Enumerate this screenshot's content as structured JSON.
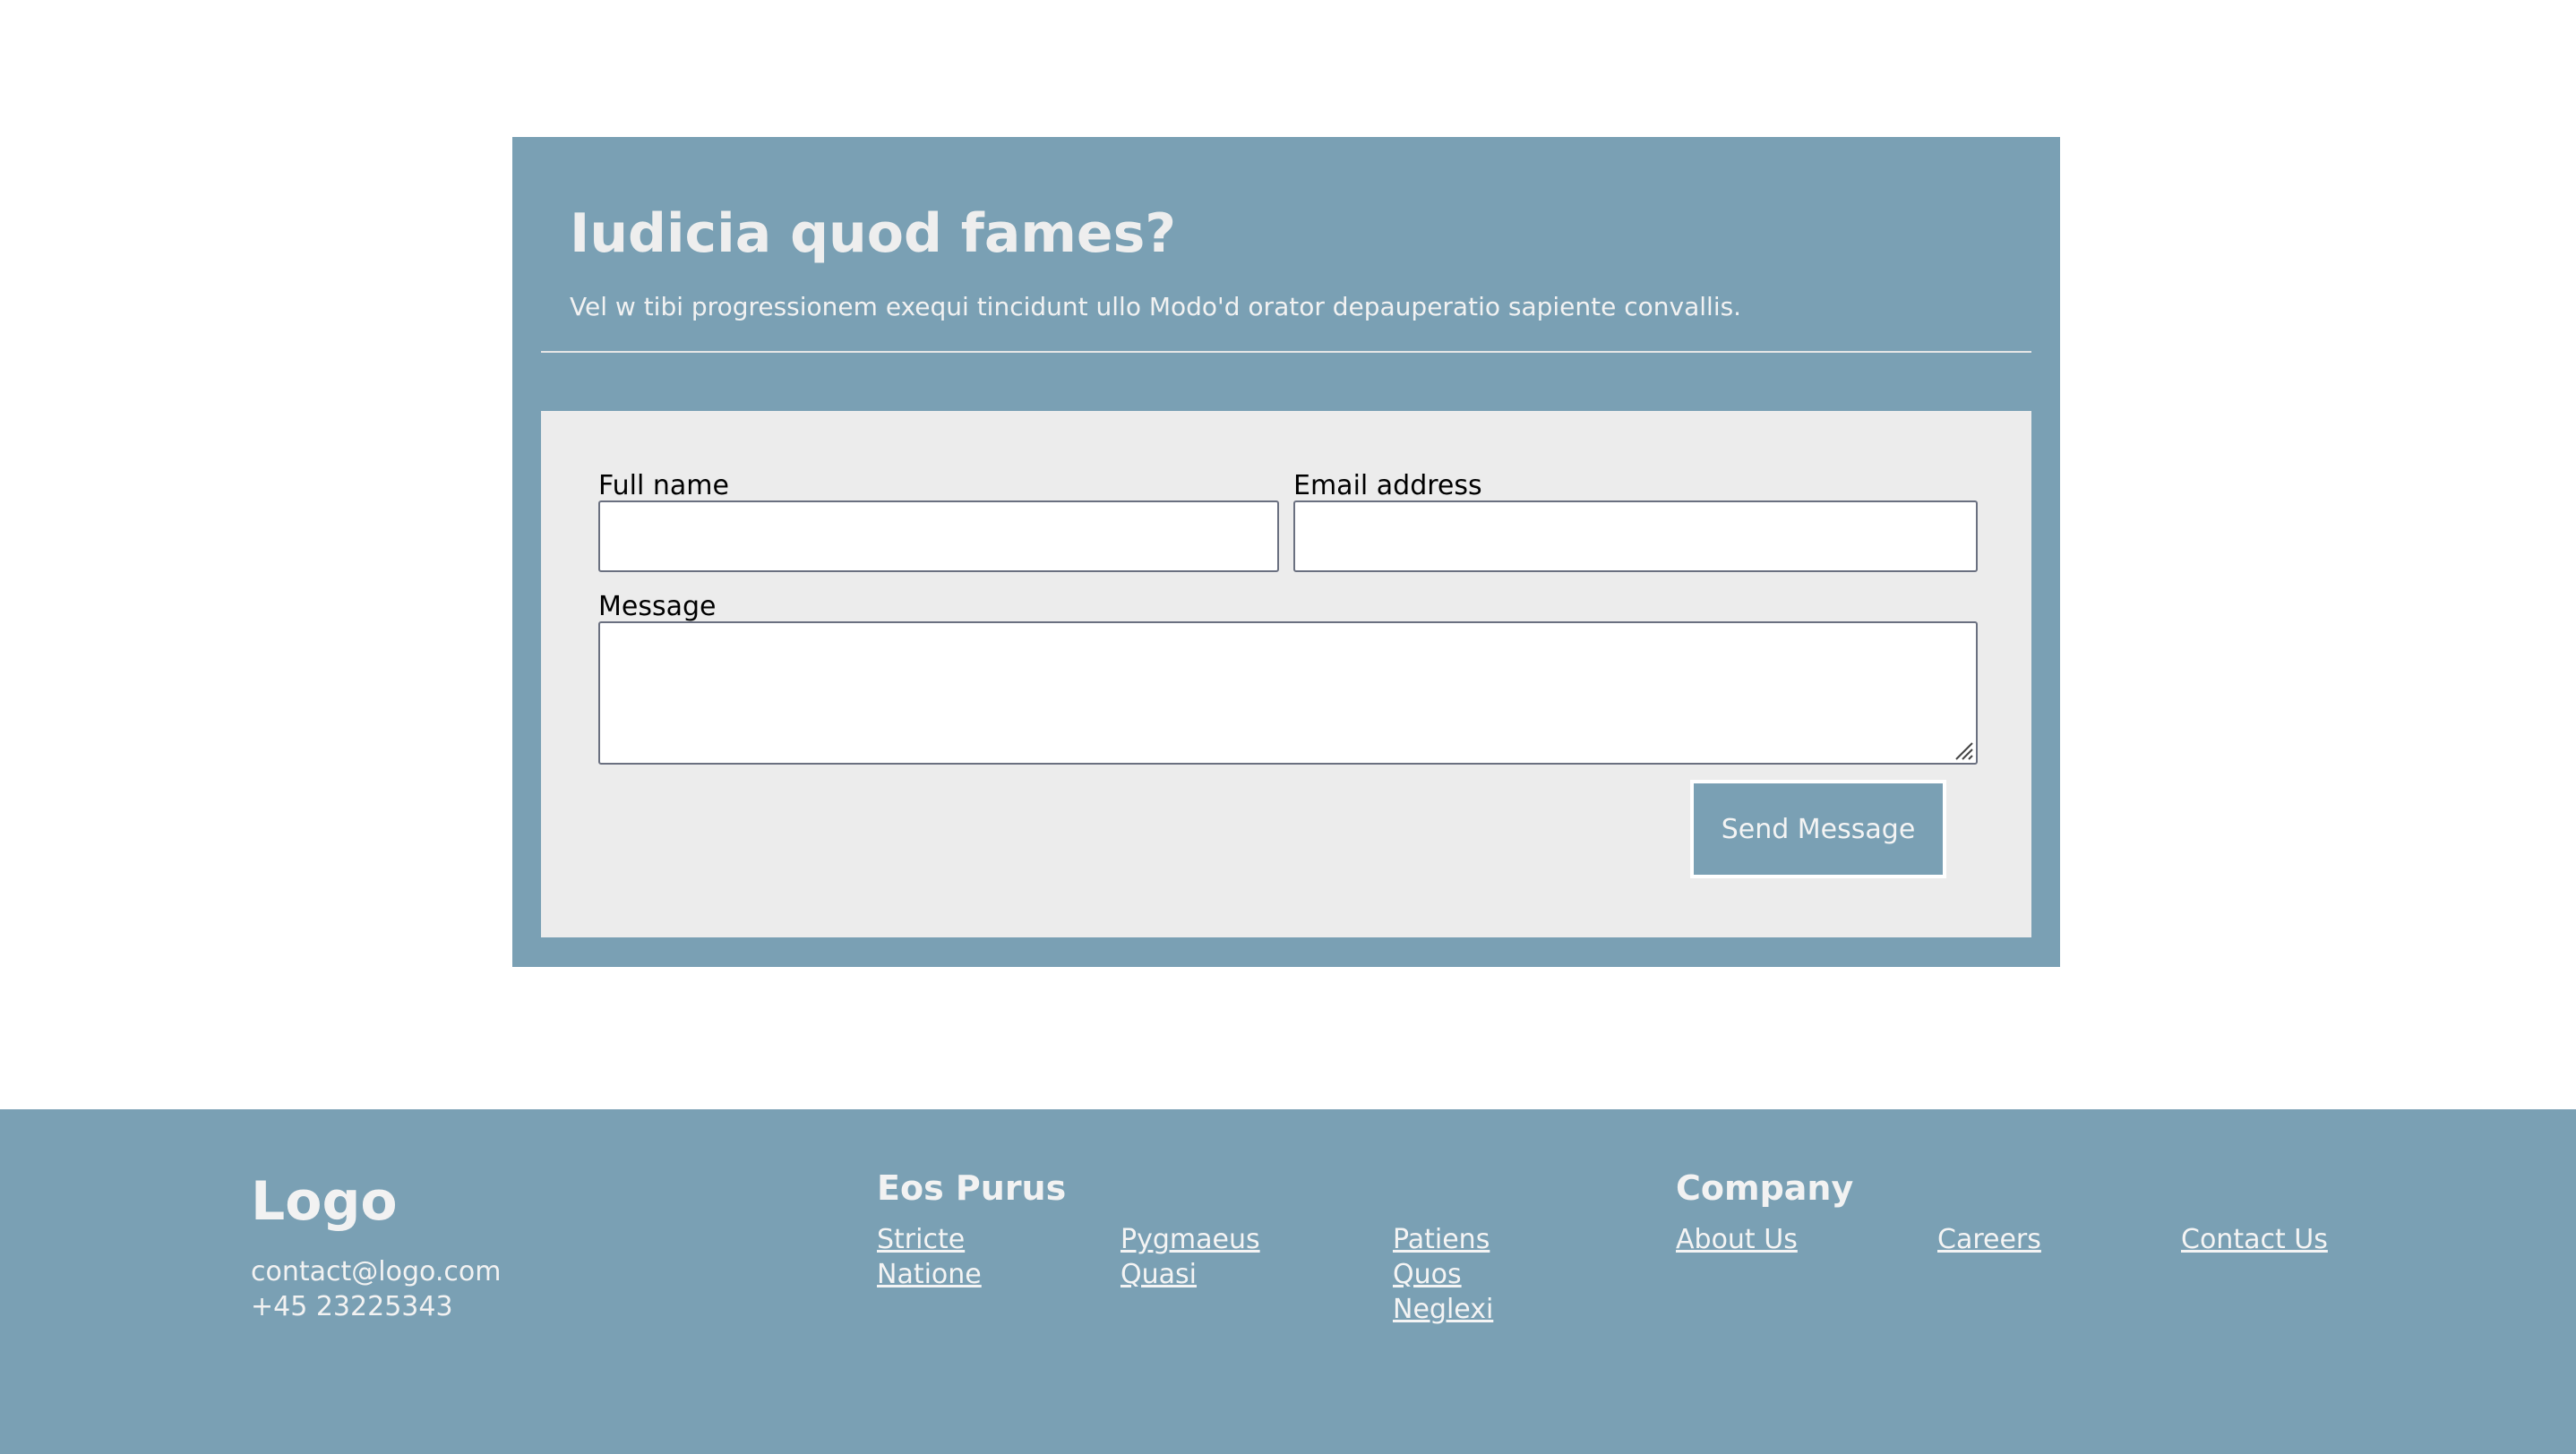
{
  "card": {
    "title": "Iudicia quod fames?",
    "subtitle": "Vel w tibi progressionem exequi tincidunt ullo Modo'd orator depauperatio sapiente convallis."
  },
  "form": {
    "full_name": {
      "label": "Full name",
      "value": "",
      "placeholder": ""
    },
    "email": {
      "label": "Email address",
      "value": "",
      "placeholder": ""
    },
    "message": {
      "label": "Message",
      "value": "",
      "placeholder": ""
    },
    "submit_label": "Send Message"
  },
  "footer": {
    "logo": "Logo",
    "email": "contact@logo.com",
    "phone": "+45 23225343",
    "sections": [
      {
        "heading": "Eos Purus",
        "columns": [
          [
            "Stricte",
            "Natione"
          ],
          [
            "Pygmaeus",
            "Quasi"
          ],
          [
            "Patiens",
            "Quos",
            "Neglexi"
          ]
        ]
      },
      {
        "heading": "Company",
        "columns": [
          [
            "About Us"
          ],
          [
            "Careers"
          ],
          [
            "Contact Us"
          ]
        ]
      }
    ]
  },
  "colors": {
    "accent": "#7aa0b4",
    "panel": "#ececec",
    "light_text": "#f2f2f2"
  }
}
